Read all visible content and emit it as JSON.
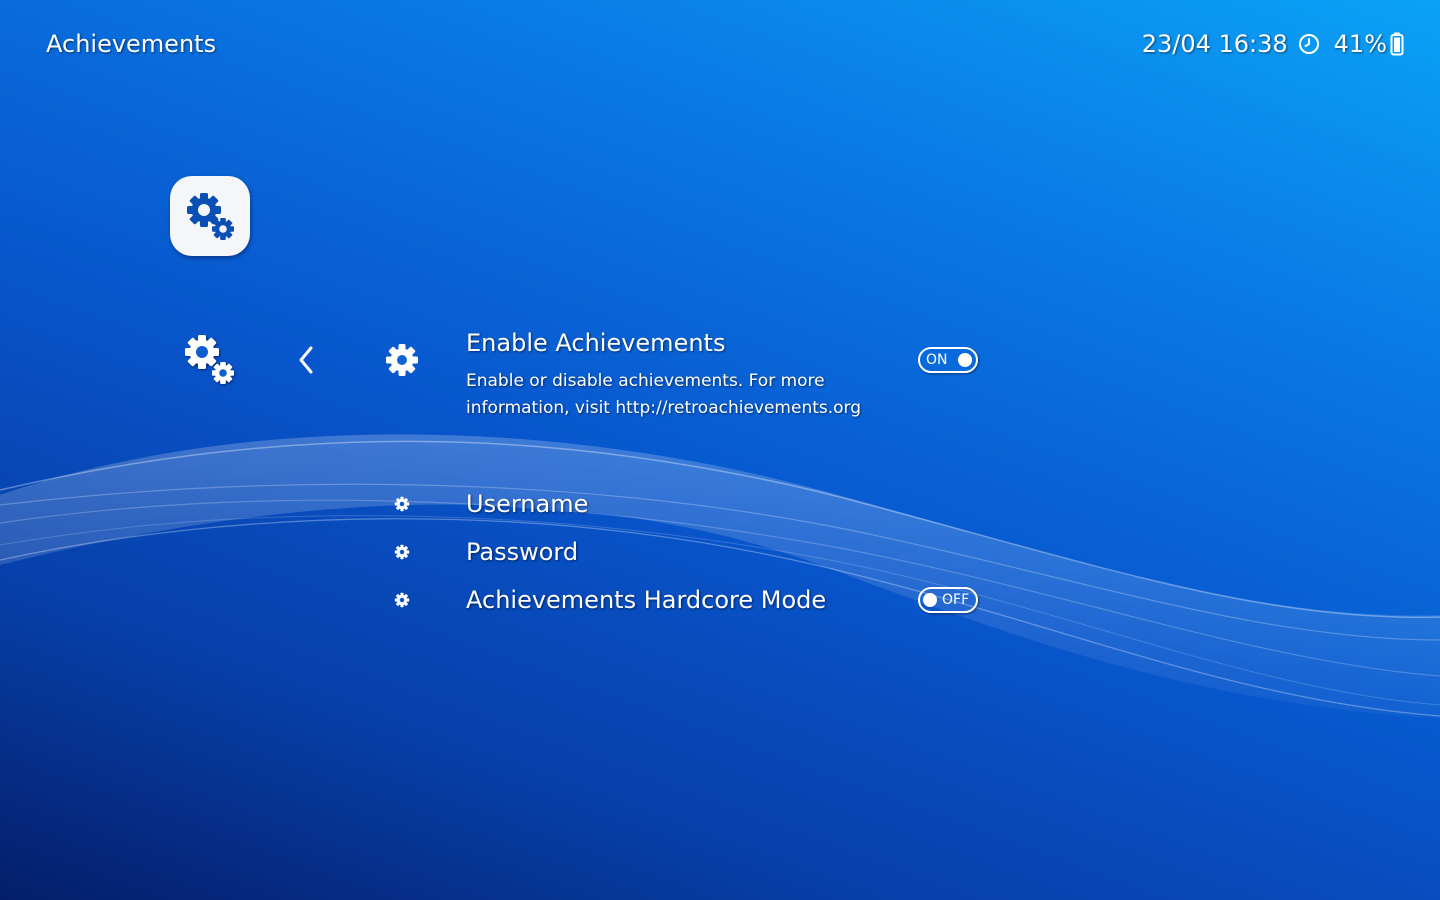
{
  "header": {
    "title": "Achievements",
    "datetime": "23/04 16:38",
    "battery": "41%"
  },
  "colors": {
    "background_top": "#0aa2f6",
    "background_bottom": "#041e6a",
    "text": "#ffffff",
    "icon_tile": "#f4f6f9",
    "icon_glyph": "#0a4fb3"
  },
  "icons": {
    "tab": "gears-icon",
    "sidebar": "gears-icon",
    "back": "chevron-left-icon",
    "item": "gear-icon",
    "clock": "clock-icon",
    "battery": "battery-icon"
  },
  "menu": {
    "items": [
      {
        "label": "Enable Achievements",
        "sublabel": "Enable or disable achievements. For more information, visit http://retroachievements.org",
        "toggle": "ON",
        "selected": true
      },
      {
        "label": "Username"
      },
      {
        "label": "Password"
      },
      {
        "label": "Achievements Hardcore Mode",
        "toggle": "OFF"
      }
    ]
  }
}
